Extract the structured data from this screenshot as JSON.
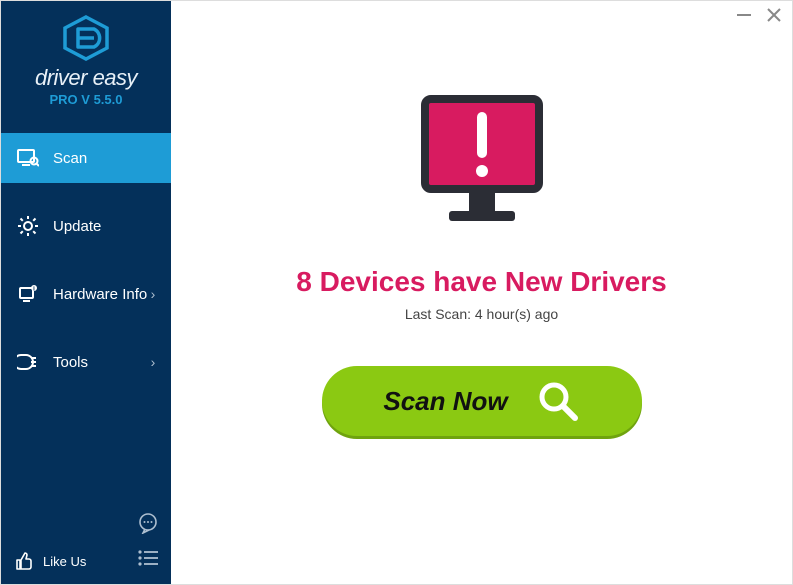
{
  "brand": {
    "name": "driver easy",
    "version": "PRO V 5.5.0"
  },
  "nav": {
    "scan": "Scan",
    "update": "Update",
    "hardware": "Hardware Info",
    "tools": "Tools"
  },
  "footer": {
    "like": "Like Us"
  },
  "main": {
    "headline": "8 Devices have New Drivers",
    "lastScan": "Last Scan: 4 hour(s) ago",
    "scanButton": "Scan Now"
  }
}
